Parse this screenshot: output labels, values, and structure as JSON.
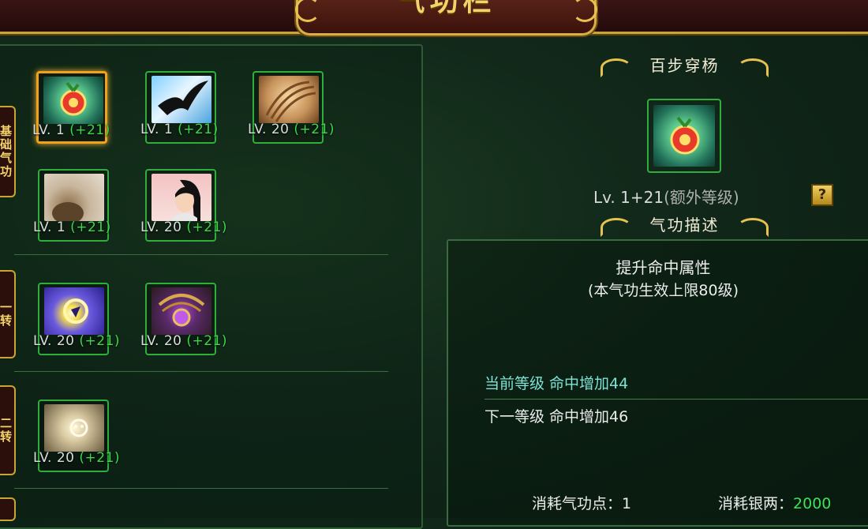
{
  "header": {
    "title": "气功栏"
  },
  "sections": [
    {
      "label": "基础气功"
    },
    {
      "label": "一转"
    },
    {
      "label": "二转"
    }
  ],
  "skills": [
    {
      "name": "百步穿杨",
      "icon": "apple-target-icon",
      "level": "LV. 1",
      "bonus": "(+21)",
      "selected": true
    },
    {
      "name": "",
      "icon": "bird-silhouette-icon",
      "level": "LV. 1",
      "bonus": "(+21)"
    },
    {
      "name": "",
      "icon": "rope-icon",
      "level": "LV. 20",
      "bonus": "(+21)"
    },
    {
      "name": "",
      "icon": "stone-icon",
      "level": "LV. 1",
      "bonus": "(+21)"
    },
    {
      "name": "",
      "icon": "female-archer-icon",
      "level": "LV. 20",
      "bonus": "(+21)"
    },
    {
      "name": "",
      "icon": "glowing-orb-icon",
      "level": "LV. 20",
      "bonus": "(+21)"
    },
    {
      "name": "",
      "icon": "amulet-icon",
      "level": "LV. 20",
      "bonus": "(+21)"
    },
    {
      "name": "",
      "icon": "smoke-burst-icon",
      "level": "LV. 20",
      "bonus": "(+21)"
    }
  ],
  "detail": {
    "skill_name": "百步穿杨",
    "level_prefix": "Lv. 1",
    "level_bonus": "+21",
    "level_extra": "(额外等级)",
    "help_label": "?",
    "desc_heading": "气功描述",
    "desc_title": "提升命中属性",
    "desc_sub": "(本气功生效上限80级)",
    "current_level_text": "当前等级  命中增加44",
    "next_level_text": "下一等级  命中增加46",
    "cost_qi_label": "消耗气功点：",
    "cost_qi_value": "1",
    "cost_silver_label": "消耗银两：",
    "cost_silver_value": "2000"
  },
  "colors": {
    "bonus_green": "#3fd64a",
    "current_level_cyan": "#7de3d4",
    "gold_trim": "#c9a437",
    "selected_border": "#f2a11a"
  }
}
